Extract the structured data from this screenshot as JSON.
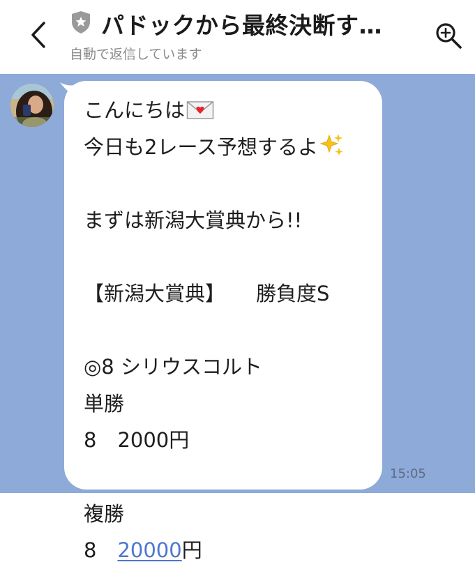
{
  "header": {
    "title": "パドックから最終決断す…",
    "subtitle": "自動で返信しています",
    "icons": {
      "back": "chevron-left-icon",
      "shield": "shield-icon",
      "search": "search-icon"
    }
  },
  "message": {
    "lines": {
      "l1": "こんにちは",
      "l2": "今日も2レース予想するよ",
      "l3": "まずは新潟大賞典から!!",
      "l4a": "【新潟大賞典】",
      "l4b": "勝負度S",
      "l5": "◎8 シリウスコルト",
      "l6": "単勝",
      "l7a": "8",
      "l7b": "2000円",
      "l8": "複勝",
      "l9a": "8",
      "l9_link": "20000",
      "l9_suffix": "円"
    },
    "emojis": {
      "letter": "envelope-heart-icon",
      "sparkles": "sparkles-icon"
    },
    "time": "15:05"
  },
  "colors": {
    "chat_background": "#8eaad8",
    "bubble": "#ffffff",
    "link": "#4f76cf",
    "header_text": "#1b1b1b",
    "subtitle": "#8a8a8a"
  }
}
